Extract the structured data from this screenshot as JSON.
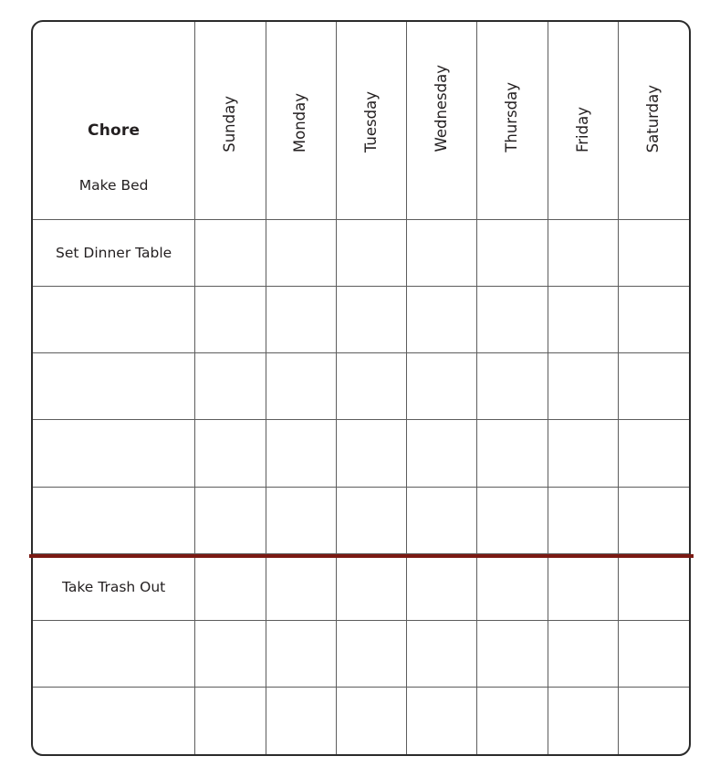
{
  "document": {
    "kind": "chore-chart",
    "background_color": "#ffffff"
  },
  "table": {
    "border_color": "#2b2b2b",
    "grid_line_color": "#5d5d5d",
    "text_color": "#231f20",
    "columns": {
      "row_header": "Chore",
      "days": [
        "Sunday",
        "Monday",
        "Tuesday",
        "Wednesday",
        "Thursday",
        "Friday",
        "Saturday"
      ]
    },
    "rows": [
      {
        "chore": "Make Bed"
      },
      {
        "chore": "Set Dinner Table"
      },
      {
        "chore": ""
      },
      {
        "chore": ""
      },
      {
        "chore": ""
      },
      {
        "chore": ""
      },
      {
        "chore": "Take Trash Out"
      },
      {
        "chore": ""
      },
      {
        "chore": ""
      }
    ]
  },
  "divider": {
    "color": "#7b1a13",
    "after_row_index": 5
  }
}
